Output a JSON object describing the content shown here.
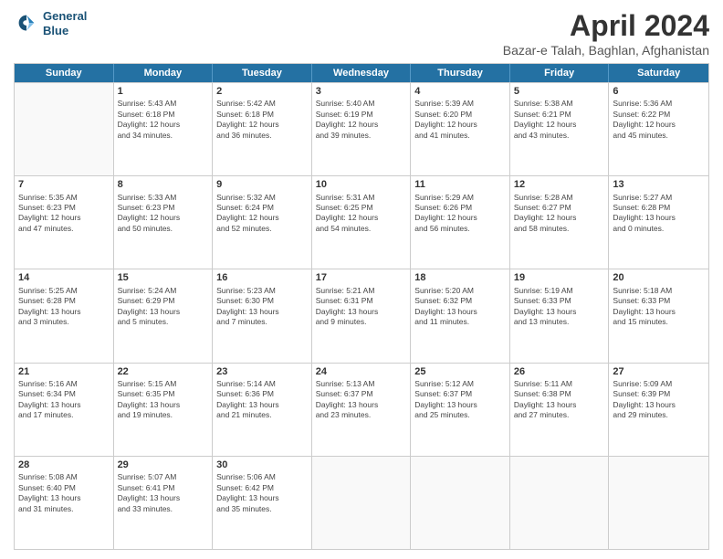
{
  "header": {
    "logo_line1": "General",
    "logo_line2": "Blue",
    "title": "April 2024",
    "subtitle": "Bazar-e Talah, Baghlan, Afghanistan"
  },
  "days": [
    "Sunday",
    "Monday",
    "Tuesday",
    "Wednesday",
    "Thursday",
    "Friday",
    "Saturday"
  ],
  "weeks": [
    [
      {
        "day": "",
        "info": ""
      },
      {
        "day": "1",
        "info": "Sunrise: 5:43 AM\nSunset: 6:18 PM\nDaylight: 12 hours\nand 34 minutes."
      },
      {
        "day": "2",
        "info": "Sunrise: 5:42 AM\nSunset: 6:18 PM\nDaylight: 12 hours\nand 36 minutes."
      },
      {
        "day": "3",
        "info": "Sunrise: 5:40 AM\nSunset: 6:19 PM\nDaylight: 12 hours\nand 39 minutes."
      },
      {
        "day": "4",
        "info": "Sunrise: 5:39 AM\nSunset: 6:20 PM\nDaylight: 12 hours\nand 41 minutes."
      },
      {
        "day": "5",
        "info": "Sunrise: 5:38 AM\nSunset: 6:21 PM\nDaylight: 12 hours\nand 43 minutes."
      },
      {
        "day": "6",
        "info": "Sunrise: 5:36 AM\nSunset: 6:22 PM\nDaylight: 12 hours\nand 45 minutes."
      }
    ],
    [
      {
        "day": "7",
        "info": "Sunrise: 5:35 AM\nSunset: 6:23 PM\nDaylight: 12 hours\nand 47 minutes."
      },
      {
        "day": "8",
        "info": "Sunrise: 5:33 AM\nSunset: 6:23 PM\nDaylight: 12 hours\nand 50 minutes."
      },
      {
        "day": "9",
        "info": "Sunrise: 5:32 AM\nSunset: 6:24 PM\nDaylight: 12 hours\nand 52 minutes."
      },
      {
        "day": "10",
        "info": "Sunrise: 5:31 AM\nSunset: 6:25 PM\nDaylight: 12 hours\nand 54 minutes."
      },
      {
        "day": "11",
        "info": "Sunrise: 5:29 AM\nSunset: 6:26 PM\nDaylight: 12 hours\nand 56 minutes."
      },
      {
        "day": "12",
        "info": "Sunrise: 5:28 AM\nSunset: 6:27 PM\nDaylight: 12 hours\nand 58 minutes."
      },
      {
        "day": "13",
        "info": "Sunrise: 5:27 AM\nSunset: 6:28 PM\nDaylight: 13 hours\nand 0 minutes."
      }
    ],
    [
      {
        "day": "14",
        "info": "Sunrise: 5:25 AM\nSunset: 6:28 PM\nDaylight: 13 hours\nand 3 minutes."
      },
      {
        "day": "15",
        "info": "Sunrise: 5:24 AM\nSunset: 6:29 PM\nDaylight: 13 hours\nand 5 minutes."
      },
      {
        "day": "16",
        "info": "Sunrise: 5:23 AM\nSunset: 6:30 PM\nDaylight: 13 hours\nand 7 minutes."
      },
      {
        "day": "17",
        "info": "Sunrise: 5:21 AM\nSunset: 6:31 PM\nDaylight: 13 hours\nand 9 minutes."
      },
      {
        "day": "18",
        "info": "Sunrise: 5:20 AM\nSunset: 6:32 PM\nDaylight: 13 hours\nand 11 minutes."
      },
      {
        "day": "19",
        "info": "Sunrise: 5:19 AM\nSunset: 6:33 PM\nDaylight: 13 hours\nand 13 minutes."
      },
      {
        "day": "20",
        "info": "Sunrise: 5:18 AM\nSunset: 6:33 PM\nDaylight: 13 hours\nand 15 minutes."
      }
    ],
    [
      {
        "day": "21",
        "info": "Sunrise: 5:16 AM\nSunset: 6:34 PM\nDaylight: 13 hours\nand 17 minutes."
      },
      {
        "day": "22",
        "info": "Sunrise: 5:15 AM\nSunset: 6:35 PM\nDaylight: 13 hours\nand 19 minutes."
      },
      {
        "day": "23",
        "info": "Sunrise: 5:14 AM\nSunset: 6:36 PM\nDaylight: 13 hours\nand 21 minutes."
      },
      {
        "day": "24",
        "info": "Sunrise: 5:13 AM\nSunset: 6:37 PM\nDaylight: 13 hours\nand 23 minutes."
      },
      {
        "day": "25",
        "info": "Sunrise: 5:12 AM\nSunset: 6:37 PM\nDaylight: 13 hours\nand 25 minutes."
      },
      {
        "day": "26",
        "info": "Sunrise: 5:11 AM\nSunset: 6:38 PM\nDaylight: 13 hours\nand 27 minutes."
      },
      {
        "day": "27",
        "info": "Sunrise: 5:09 AM\nSunset: 6:39 PM\nDaylight: 13 hours\nand 29 minutes."
      }
    ],
    [
      {
        "day": "28",
        "info": "Sunrise: 5:08 AM\nSunset: 6:40 PM\nDaylight: 13 hours\nand 31 minutes."
      },
      {
        "day": "29",
        "info": "Sunrise: 5:07 AM\nSunset: 6:41 PM\nDaylight: 13 hours\nand 33 minutes."
      },
      {
        "day": "30",
        "info": "Sunrise: 5:06 AM\nSunset: 6:42 PM\nDaylight: 13 hours\nand 35 minutes."
      },
      {
        "day": "",
        "info": ""
      },
      {
        "day": "",
        "info": ""
      },
      {
        "day": "",
        "info": ""
      },
      {
        "day": "",
        "info": ""
      }
    ]
  ]
}
